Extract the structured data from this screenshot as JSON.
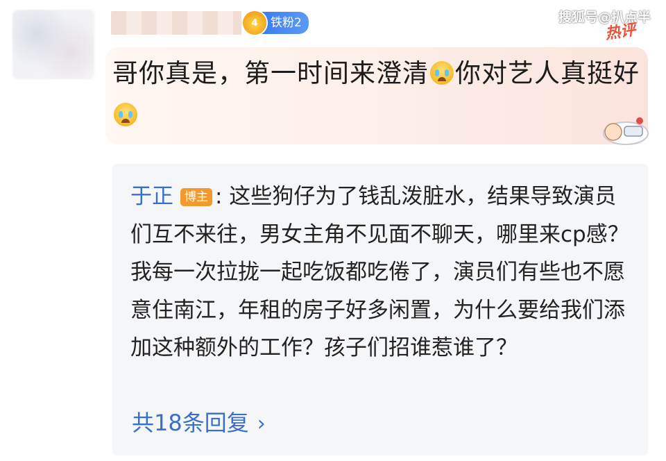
{
  "watermark": "搜狐号@扒点半",
  "hot_tag": "热评",
  "comment": {
    "fan_badge_level": "4",
    "fan_badge_label": "铁粉2",
    "text_part1": "哥你真是，第一时间来澄清",
    "text_part2": "你对艺人真挺好",
    "emoji": "crying-face-icon"
  },
  "reply": {
    "author": "于正",
    "author_tag": "博主",
    "separator": ":",
    "text": " 这些狗仔为了钱乱泼脏水，结果导致演员们互不来往，男女主角不见面不聊天，哪里来cp感？我每一次拉拢一起吃饭都吃倦了，演员们有些也不愿意住南江，年租的房子好多闲置，为什么要给我们添加这种额外的工作？孩子们招谁惹谁了？"
  },
  "replies_link": {
    "label": "共18条回复",
    "chevron": "›"
  }
}
